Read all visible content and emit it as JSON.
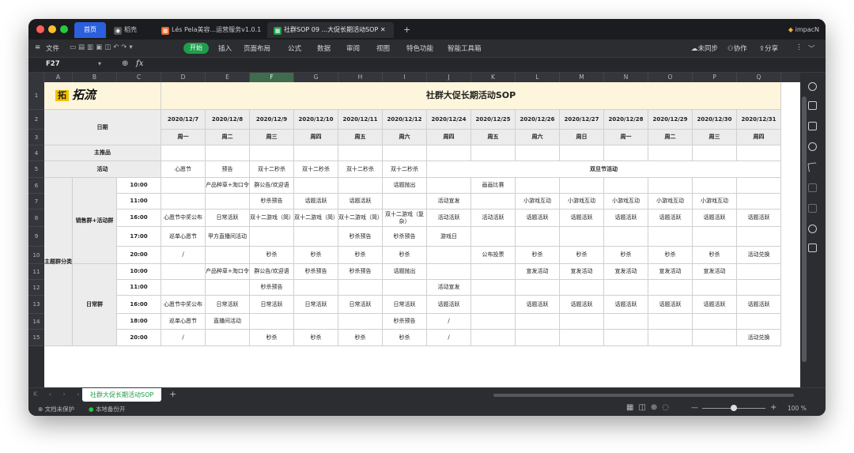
{
  "tabs": {
    "home": "首页",
    "doc1": "稻壳",
    "doc2": "Lés Pela美容...运营服务v1.0.1",
    "doc3": "社群SOP 09 ...大促长期活动SOP",
    "new_tab": "+",
    "account": "impacN"
  },
  "menu": {
    "file": "文件",
    "start": "开始",
    "insert": "插入",
    "page_layout": "页面布局",
    "formula": "公式",
    "data": "数据",
    "review": "审阅",
    "view": "视图",
    "features": "特色功能",
    "smart_tools": "智能工具箱",
    "unsynced": "未同步",
    "collaborate": "协作",
    "share": "分享"
  },
  "formula": {
    "cell_ref": "F27",
    "fx": "fx"
  },
  "columns": [
    "A",
    "B",
    "C",
    "D",
    "E",
    "F",
    "G",
    "H",
    "I",
    "J",
    "K",
    "L",
    "M",
    "N",
    "O",
    "P",
    "Q"
  ],
  "rows": [
    "1",
    "2",
    "3",
    "4",
    "5",
    "6",
    "7",
    "8",
    "9",
    "10",
    "11",
    "12",
    "13",
    "14",
    "15"
  ],
  "sheet": {
    "logo_mark": "拓",
    "logo_text": "拓流",
    "title": "社群大促长期活动SOP",
    "date_label": "日期",
    "dates": [
      "2020/12/7",
      "2020/12/8",
      "2020/12/9",
      "2020/12/10",
      "2020/12/11",
      "2020/12/12",
      "2020/12/24",
      "2020/12/25",
      "2020/12/26",
      "2020/12/27",
      "2020/12/28",
      "2020/12/29",
      "2020/12/30",
      "2020/12/31"
    ],
    "weekdays": [
      "周一",
      "周二",
      "周三",
      "周四",
      "周五",
      "周六",
      "周四",
      "周五",
      "周六",
      "周日",
      "周一",
      "周二",
      "周三",
      "周四"
    ],
    "main_product_label": "主推品",
    "activity_label": "活动",
    "activities": [
      "心愿节",
      "预告",
      "双十二秒杀",
      "双十二秒杀",
      "双十二秒杀",
      "双十二秒杀"
    ],
    "holiday_label": "双旦节活动",
    "group_class_label": "主题群分类",
    "group1_label": "销售群+活动群",
    "group2_label": "日常群",
    "times1": [
      "10:00",
      "11:00",
      "16:00",
      "17:00",
      "20:00"
    ],
    "times2": [
      "10:00",
      "11:00",
      "16:00",
      "18:00",
      "20:00"
    ],
    "grid1": [
      [
        "",
        "产品种草+淘口令",
        "群公告/欢迎语",
        "",
        "",
        "话题抛出",
        "",
        "画画比赛",
        "",
        "",
        "",
        "",
        "",
        ""
      ],
      [
        "",
        "",
        "秒杀预告",
        "话题活跃",
        "话题活跃",
        "",
        "活动宣发",
        "",
        "小游戏互动",
        "小游戏互动",
        "小游戏互动",
        "小游戏互动",
        "小游戏互动",
        ""
      ],
      [
        "心愿节中奖公布",
        "日常活跃",
        "双十二游戏（简）",
        "双十二游戏（简）",
        "双十二游戏（简）",
        "双十二游戏（复杂）",
        "活动活跃",
        "活动活跃",
        "话题活跃",
        "话题活跃",
        "话题活跃",
        "话题活跃",
        "话题活跃",
        "话题活跃"
      ],
      [
        "巡单心愿节",
        "甲方直播间活动",
        "",
        "",
        "秒杀预告",
        "秒杀预告",
        "游戏日",
        "",
        "",
        "",
        "",
        "",
        "",
        ""
      ],
      [
        "/",
        "",
        "秒杀",
        "秒杀",
        "秒杀",
        "秒杀",
        "",
        "公布投票",
        "秒杀",
        "秒杀",
        "秒杀",
        "秒杀",
        "秒杀",
        "活动兑换"
      ]
    ],
    "grid2": [
      [
        "",
        "产品种草+淘口令",
        "群公告/欢迎语",
        "秒杀预告",
        "秒杀预告",
        "话题抛出",
        "",
        "",
        "宣发活动",
        "宣发活动",
        "宣发活动",
        "宣发活动",
        "宣发活动",
        ""
      ],
      [
        "",
        "",
        "秒杀预告",
        "",
        "",
        "",
        "活动宣发",
        "",
        "",
        "",
        "",
        "",
        "",
        ""
      ],
      [
        "心愿节中奖公布",
        "日常活跃",
        "日常活跃",
        "日常活跃",
        "日常活跃",
        "日常活跃",
        "话题活跃",
        "",
        "话题活跃",
        "话题活跃",
        "话题活跃",
        "话题活跃",
        "话题活跃",
        "话题活跃"
      ],
      [
        "巡单心愿节",
        "直播间活动",
        "",
        "",
        "",
        "秒杀预告",
        "/",
        "",
        "",
        "",
        "",
        "",
        "",
        ""
      ],
      [
        "/",
        "",
        "秒杀",
        "秒杀",
        "秒杀",
        "秒杀",
        "/",
        "",
        "",
        "",
        "",
        "",
        "",
        "活动兑换"
      ]
    ]
  },
  "sheet_tab": "社群大促长期活动SOP",
  "status": {
    "protect": "文档未保护",
    "backup": "本地备份开",
    "zoom": "100 %"
  }
}
